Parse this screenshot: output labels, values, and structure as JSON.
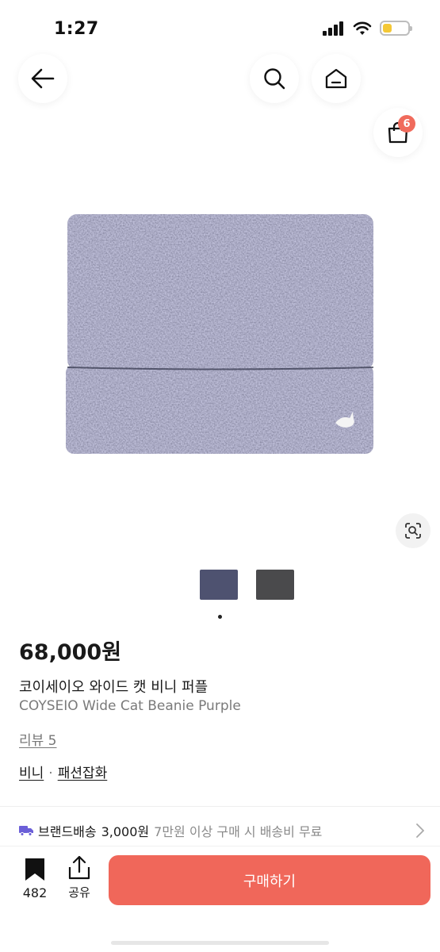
{
  "status_bar": {
    "time": "1:27",
    "battery_level": 0.38
  },
  "nav": {
    "cart_count": "6"
  },
  "colors": {
    "accent": "#f0675a",
    "badge": "#f06b5c",
    "shipping_icon": "#6b5fd8"
  },
  "product": {
    "price": "68,000원",
    "title_ko": "코이세이오 와이드 캣 비니 퍼플",
    "title_en": "COYSEIO Wide Cat Beanie Purple",
    "review_label": "리뷰 5",
    "categories": [
      "비니",
      "패션잡화"
    ],
    "thumbnails": [
      "purple",
      "gray"
    ]
  },
  "shipping": {
    "brand_label": "브랜드배송",
    "cost": "3,000원",
    "note": "7만원 이상 구매 시 배송비 무료"
  },
  "bottom_bar": {
    "bookmark_count": "482",
    "share_label": "공유",
    "buy_label": "구매하기"
  },
  "icons": [
    "back-arrow-icon",
    "search-icon",
    "home-icon",
    "cart-icon",
    "lens-icon",
    "truck-icon",
    "chevron-right-icon",
    "bookmark-icon",
    "share-icon"
  ]
}
